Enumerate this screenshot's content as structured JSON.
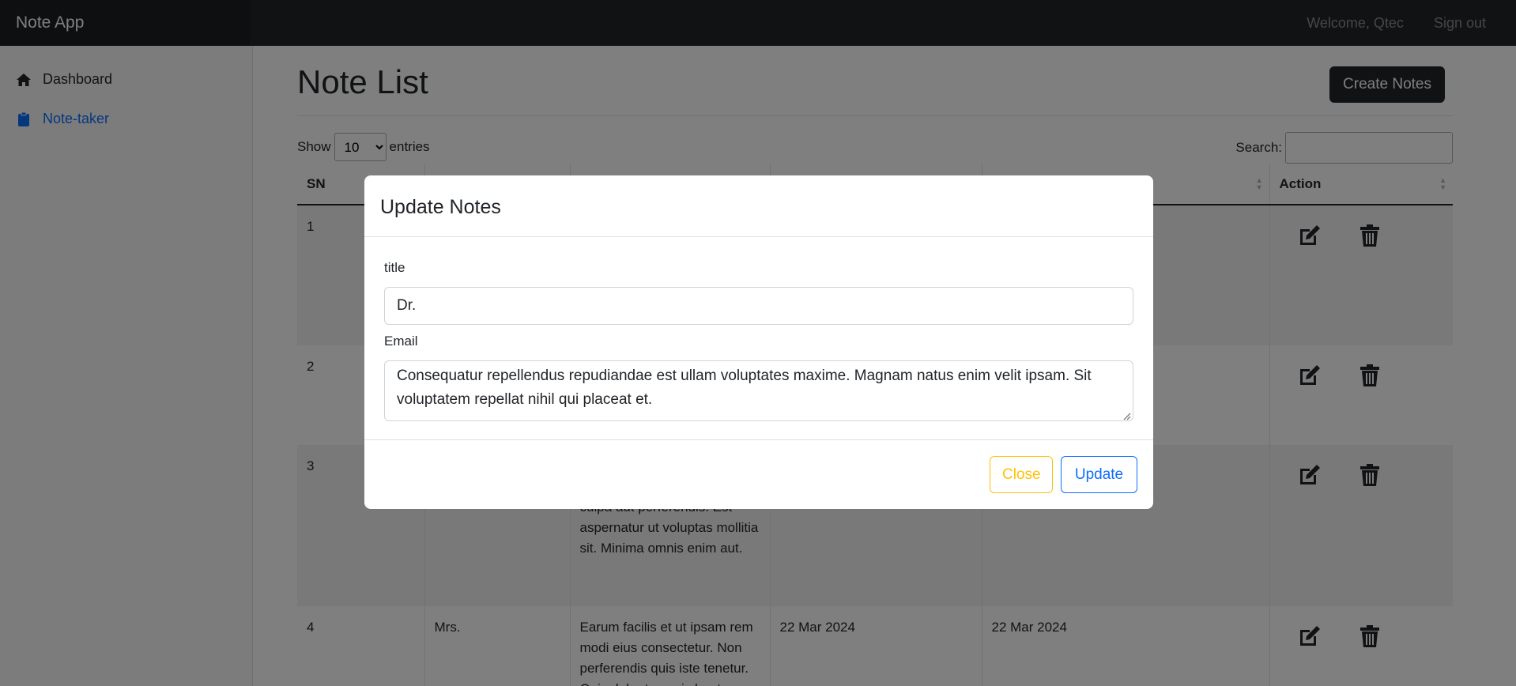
{
  "navbar": {
    "brand": "Note App",
    "welcome": "Welcome, Qtec",
    "signout": "Sign out"
  },
  "sidebar": {
    "items": [
      {
        "label": "Dashboard",
        "icon": "house-icon"
      },
      {
        "label": "Note-taker",
        "icon": "clipboard-icon",
        "active": true
      }
    ]
  },
  "main": {
    "title": "Note List",
    "create_button": "Create Notes",
    "show_label": "Show",
    "entries_value": "10",
    "entries_label": "entries",
    "search_label": "Search:"
  },
  "table": {
    "headers": [
      "SN",
      "",
      "",
      "",
      "",
      "Action"
    ],
    "rows": [
      {
        "sn": "1",
        "title": "",
        "note": "",
        "created": "",
        "updated": ""
      },
      {
        "sn": "2",
        "title": "",
        "note": "",
        "created": "",
        "updated": ""
      },
      {
        "sn": "3",
        "title": "",
        "note": "culpa aut perferendis. Est aspernatur ut voluptas mollitia sit. Minima omnis enim aut.",
        "created": "",
        "updated": ""
      },
      {
        "sn": "4",
        "title": "Mrs.",
        "note": "Earum facilis et ut ipsam rem modi eius consectetur. Non perferendis quis iste tenetur. Quis dolor tus quis beatae",
        "created": "22 Mar 2024",
        "updated": "22 Mar 2024"
      }
    ]
  },
  "modal": {
    "title": "Update Notes",
    "title_label": "title",
    "title_value": "Dr.",
    "email_label": "Email",
    "email_value": "Consequatur repellendus repudiandae est ullam voluptates maxime. Magnam natus enim velit ipsam. Sit voluptatem repellat nihil qui placeat et.",
    "close_button": "Close",
    "update_button": "Update"
  },
  "colors": {
    "navbar_bg": "#212529",
    "accent": "#0d6efd",
    "warning": "#ffc107"
  }
}
